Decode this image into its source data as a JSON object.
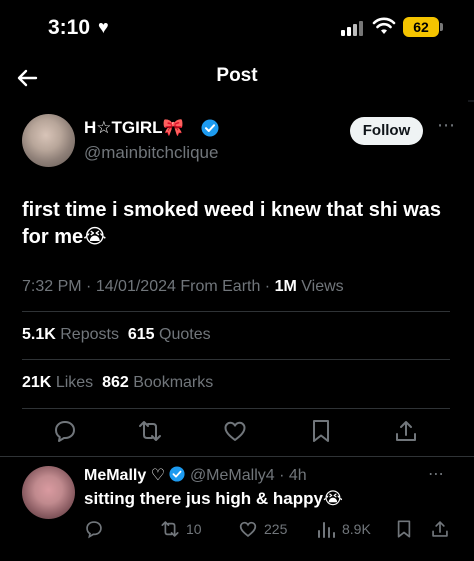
{
  "status_bar": {
    "time": "3:10",
    "battery": "62",
    "colors": {
      "battery_fill": "#f5c400"
    }
  },
  "header": {
    "title": "Post",
    "back_icon": "arrow-left-icon"
  },
  "tweet": {
    "display_name": "H☆TGIRL🎀",
    "handle": "@mainbitchclique",
    "follow_label": "Follow",
    "text": "first time i smoked weed i knew that shi was for me😭",
    "time": "7:32 PM",
    "date": "14/01/2024",
    "location": "From Earth",
    "views_count": "1M",
    "views_label": "Views",
    "reposts_count": "5.1K",
    "reposts_label": "Reposts",
    "quotes_count": "615",
    "quotes_label": "Quotes",
    "likes_count": "21K",
    "likes_label": "Likes",
    "bookmarks_count": "862",
    "bookmarks_label": "Bookmarks",
    "action_icons": [
      "reply-icon",
      "retweet-icon",
      "like-icon",
      "bookmark-icon",
      "share-icon"
    ],
    "colors": {
      "verified": "#1d9bf0"
    }
  },
  "reply": {
    "display_name": "MeMally ♡",
    "handle": "@MeMally4",
    "age": "4h",
    "text": "sitting there jus high & happy😭",
    "retweets": "10",
    "likes": "225",
    "views": "8.9K"
  }
}
